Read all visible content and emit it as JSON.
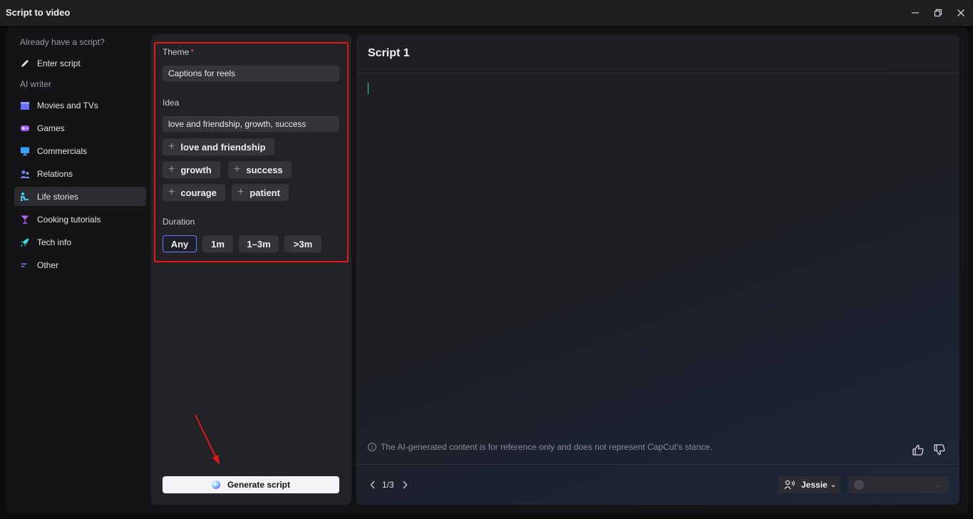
{
  "window": {
    "title": "Script to video"
  },
  "sidebar": {
    "section_existing": "Already have a script?",
    "enter_script": "Enter script",
    "section_ai": "AI writer",
    "items": [
      {
        "label": "Movies and TVs",
        "icon": "clapperboard-icon",
        "color": "#6a6dff"
      },
      {
        "label": "Games",
        "icon": "gamepad-icon",
        "color": "#9b5cff"
      },
      {
        "label": "Commercials",
        "icon": "monitor-icon",
        "color": "#3aa3ff"
      },
      {
        "label": "Relations",
        "icon": "users-icon",
        "color": "#6c7dff"
      },
      {
        "label": "Life stories",
        "icon": "person-seat-icon",
        "color": "#3cc8ff",
        "active": true
      },
      {
        "label": "Cooking tutorials",
        "icon": "cocktail-icon",
        "color": "#b463ff"
      },
      {
        "label": "Tech info",
        "icon": "rocket-icon",
        "color": "#3ad3e0"
      },
      {
        "label": "Other",
        "icon": "lines-icon",
        "color": "#7f86ff"
      }
    ]
  },
  "form": {
    "theme_label": "Theme",
    "theme_required": "*",
    "theme_value": "Captions for reels",
    "idea_label": "Idea",
    "idea_value": "love and friendship, growth, success",
    "idea_chips": [
      "love and friendship",
      "growth",
      "success",
      "courage",
      "patient"
    ],
    "duration_label": "Duration",
    "durations": [
      "Any",
      "1m",
      "1–3m",
      ">3m"
    ],
    "duration_selected": "Any",
    "generate_label": "Generate script"
  },
  "script": {
    "title": "Script 1",
    "notice": "The AI-generated content is for reference only and does not represent CapCut’s stance.",
    "page": "1/3",
    "voice": "Jessie"
  },
  "colors": {
    "highlight": "#e01818",
    "accent": "#6d7bff"
  }
}
